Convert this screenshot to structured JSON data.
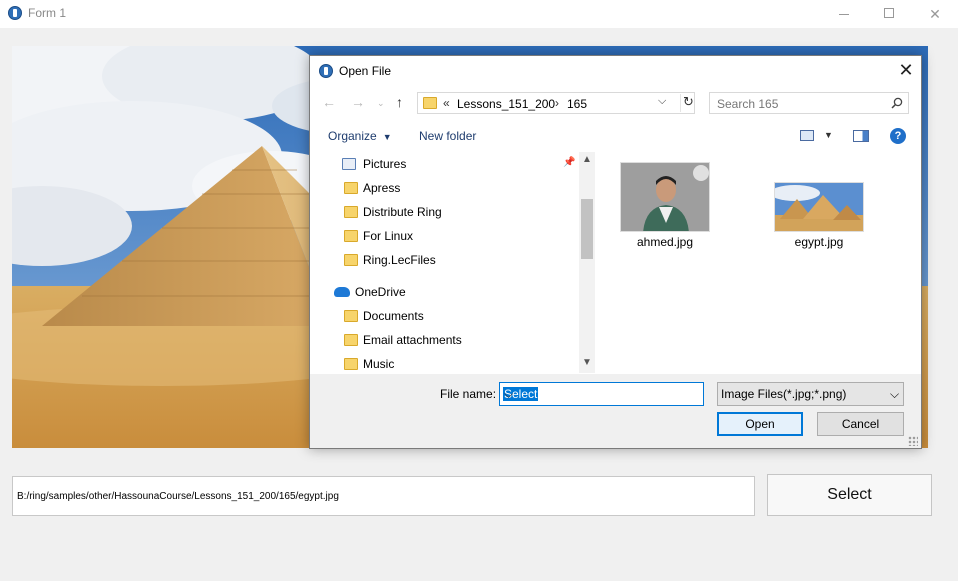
{
  "window": {
    "title": "Form 1"
  },
  "main": {
    "path_value": "B:/ring/samples/other/HassounaCourse/Lessons_151_200/165/egypt.jpg",
    "select_label": "Select"
  },
  "dialog": {
    "title": "Open File",
    "close_glyph": "✕",
    "address": {
      "overflow_chevron": "«",
      "segments": [
        "Lessons_151_200",
        "165"
      ],
      "separator": "›"
    },
    "search_placeholder": "Search 165",
    "toolbar": {
      "organize_label": "Organize",
      "new_folder_label": "New folder",
      "help_glyph": "?"
    },
    "nav_items": [
      {
        "label": "Pictures",
        "icon": "pictures-icon"
      },
      {
        "label": "Apress",
        "icon": "folder-icon"
      },
      {
        "label": "Distribute Ring",
        "icon": "folder-icon"
      },
      {
        "label": "For Linux",
        "icon": "folder-icon"
      },
      {
        "label": "Ring.LecFiles",
        "icon": "folder-icon"
      },
      {
        "label": "OneDrive",
        "icon": "onedrive-icon"
      },
      {
        "label": "Documents",
        "icon": "folder-icon"
      },
      {
        "label": "Email attachments",
        "icon": "folder-icon"
      },
      {
        "label": "Music",
        "icon": "folder-icon"
      }
    ],
    "files": [
      {
        "name": "ahmed.jpg"
      },
      {
        "name": "egypt.jpg"
      }
    ],
    "file_name_label": "File name:",
    "file_name_value": "Select",
    "file_type": "Image Files(*.jpg;*.png)",
    "open_label": "Open",
    "cancel_label": "Cancel"
  },
  "colors": {
    "accent": "#0078d7",
    "folder": "#f7d46b",
    "sky": "#4a82c4",
    "sand": "#d9a850"
  }
}
